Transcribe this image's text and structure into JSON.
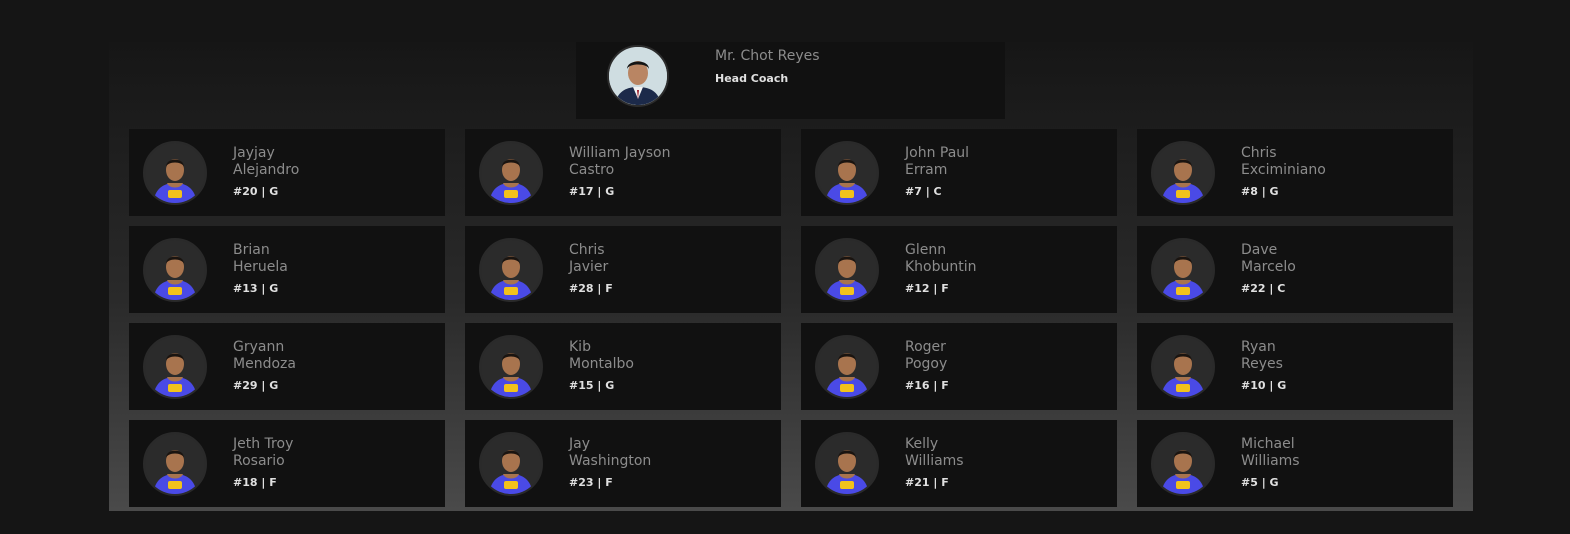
{
  "coach": {
    "name": "Mr. Chot Reyes",
    "role": "Head Coach"
  },
  "players": [
    {
      "first": "Jayjay",
      "last": "Alejandro",
      "meta": "#20 | G"
    },
    {
      "first": "William Jayson",
      "last": "Castro",
      "meta": "#17 | G"
    },
    {
      "first": "John Paul",
      "last": "Erram",
      "meta": "#7 | C"
    },
    {
      "first": "Chris",
      "last": "Exciminiano",
      "meta": "#8 | G"
    },
    {
      "first": "Brian",
      "last": "Heruela",
      "meta": "#13 | G"
    },
    {
      "first": "Chris",
      "last": "Javier",
      "meta": "#28 | F"
    },
    {
      "first": "Glenn",
      "last": "Khobuntin",
      "meta": "#12 | F"
    },
    {
      "first": "Dave",
      "last": "Marcelo",
      "meta": "#22 | C"
    },
    {
      "first": "Gryann",
      "last": "Mendoza",
      "meta": "#29 | G"
    },
    {
      "first": "Kib",
      "last": "Montalbo",
      "meta": "#15 | G"
    },
    {
      "first": "Roger",
      "last": "Pogoy",
      "meta": "#16 | F"
    },
    {
      "first": "Ryan",
      "last": "Reyes",
      "meta": "#10 | G"
    },
    {
      "first": "Jeth Troy",
      "last": "Rosario",
      "meta": "#18 | F"
    },
    {
      "first": "Jay",
      "last": "Washington",
      "meta": "#23 | F"
    },
    {
      "first": "Kelly",
      "last": "Williams",
      "meta": "#21 | F"
    },
    {
      "first": "Michael",
      "last": "Williams",
      "meta": "#5 | G"
    }
  ],
  "colors": {
    "jersey": "#4a4ae6",
    "jersey_logo": "#f2c21b",
    "skin": "#a8744e",
    "hair": "#1a1410"
  },
  "icons": {
    "coach_photo": "coach-portrait",
    "player_photo": "player-portrait"
  }
}
